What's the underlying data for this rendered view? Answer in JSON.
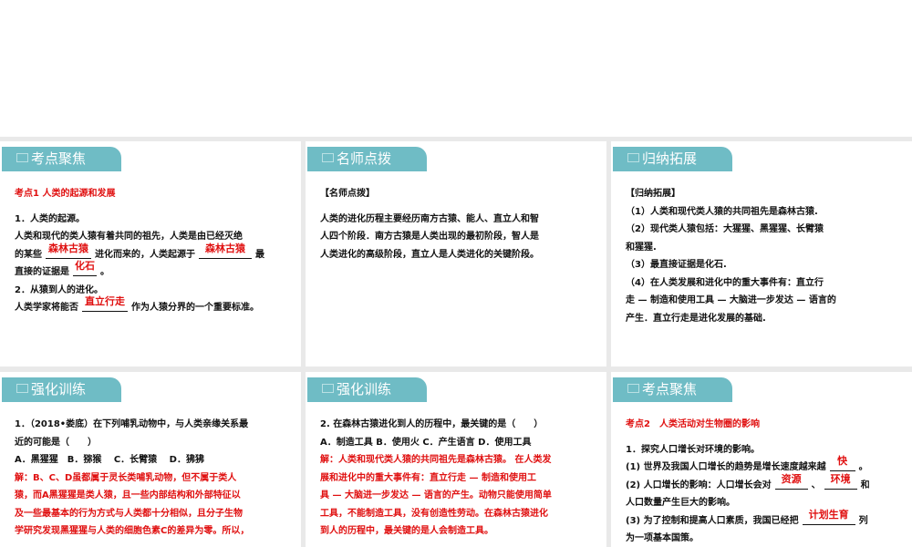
{
  "panels": [
    {
      "tab": "考点聚焦",
      "lines": [
        [
          {
            "t": "考点1  人类的起源和发展",
            "red": true
          }
        ],
        "gap",
        [
          {
            "t": "1．人类的起源。"
          }
        ],
        [
          {
            "t": "人类和现代的类人猿有着共同的祖先，人类是由已经灭绝"
          }
        ],
        [
          {
            "t": "的某些"
          },
          {
            "ans": "森林古猿",
            "w": 50
          },
          {
            "t": "进化而来的，人类起源于"
          },
          {
            "ans": "森林古猿",
            "w": 58
          },
          {
            "t": "最"
          }
        ],
        [
          {
            "t": "直接的证据是"
          },
          {
            "ans": "化石",
            "w": 26
          },
          {
            "t": "。"
          }
        ],
        [
          {
            "t": "2．从猿到人的进化。"
          }
        ],
        [
          {
            "t": "人类学家将能否"
          },
          {
            "ans": "直立行走",
            "w": 50
          },
          {
            "t": "作为人猿分界的一个重要标准。"
          }
        ]
      ]
    },
    {
      "tab": "名师点拨",
      "lines": [
        [
          {
            "t": "【名师点拨】"
          }
        ],
        "gap",
        [
          {
            "t": "人类的进化历程主要经历南方古猿、能人、直立人和智"
          }
        ],
        [
          {
            "t": "人四个阶段．南方古猿是人类出现的最初阶段，智人是"
          }
        ],
        [
          {
            "t": "人类进化的高级阶段，直立人是人类进化的关键阶段。"
          }
        ]
      ]
    },
    {
      "tab": "归纳拓展",
      "lines": [
        [
          {
            "t": "【归纳拓展】"
          }
        ],
        [
          {
            "t": "（1）人类和现代类人猿的共同祖先是森林古猿."
          }
        ],
        [
          {
            "t": "（2）现代类人猿包括：大猩猩、黑猩猩、长臂猿"
          }
        ],
        [
          {
            "t": "和猩猩."
          }
        ],
        [
          {
            "t": "（3）最直接证据是化石."
          }
        ],
        [
          {
            "t": "（4）在人类发展和进化中的重大事件有：直立行"
          }
        ],
        [
          {
            "t": "走 — 制造和使用工具 — 大脑进一步发达 — 语言的"
          }
        ],
        [
          {
            "t": "产生．直立行走是进化发展的基础."
          }
        ]
      ]
    },
    {
      "tab": "强化训练",
      "lines": [
        [
          {
            "t": "1．（2018•娄底）在下列哺乳动物中，与人类亲缘关系最"
          }
        ],
        [
          {
            "t": "近的可能是（　　）"
          }
        ],
        [
          {
            "t": "A．黑猩猩　B．猕猴　 C．长臂猿　 D．狒狒"
          }
        ],
        [
          {
            "t": "解：B、C、D虽都属于灵长类哺乳动物，但不属于类人",
            "red": true
          }
        ],
        [
          {
            "t": "猿，而A黑猩猩是类人猿，且一些内部结构和外部特征以",
            "red": true
          }
        ],
        [
          {
            "t": "及一些最基本的行为方式与人类都十分相似，且分子生物",
            "red": true
          }
        ],
        [
          {
            "t": "学研究发现黑猩猩与人类的细胞色素C的差异为零。所以，",
            "red": true
          }
        ]
      ]
    },
    {
      "tab": "强化训练",
      "lines": [
        [
          {
            "t": "2. 在森林古猿进化到人的历程中，最关键的是（　　）"
          }
        ],
        [
          {
            "t": "A．制造工具 B．使用火 C．产生语言 D．使用工具"
          }
        ],
        [
          {
            "t": "解：人类和现代类人猿的共同祖先是森林古猿。 在人类发",
            "red": true
          }
        ],
        [
          {
            "t": "展和进化中的重大事件有：直立行走 — 制造和使用工",
            "red": true
          }
        ],
        [
          {
            "t": "具 — 大脑进一步发达 — 语言的产生。动物只能使用简单",
            "red": true
          }
        ],
        [
          {
            "t": "工具，不能制造工具，没有创造性劳动。在森林古猿进化",
            "red": true
          }
        ],
        [
          {
            "t": "到人的历程中，最关键的是人会制造工具。",
            "red": true
          }
        ]
      ]
    },
    {
      "tab": "考点聚焦",
      "lines": [
        [
          {
            "t": "考点2　人类活动对生物圈的影响",
            "red": true
          }
        ],
        "gap",
        [
          {
            "t": "1．探究人口增长对环境的影响。"
          }
        ],
        [
          {
            "t": "(1) 世界及我国人口增长的趋势是增长速度越来越"
          },
          {
            "ans": "快",
            "w": 28
          },
          {
            "t": "。"
          }
        ],
        [
          {
            "t": "(2) 人口增长的影响：人口增长会对"
          },
          {
            "ans": "资源",
            "w": 36
          },
          {
            "t": "、"
          },
          {
            "ans": "环境",
            "w": 36
          },
          {
            "t": "和"
          }
        ],
        [
          {
            "t": "人口数量产生巨大的影响。"
          }
        ],
        [
          {
            "t": "(3) 为了控制和提高人口素质，我国已经把"
          },
          {
            "ans": "计划生育",
            "w": 58
          },
          {
            "t": "列"
          }
        ],
        [
          {
            "t": "为一项基本国策。"
          }
        ]
      ]
    }
  ]
}
